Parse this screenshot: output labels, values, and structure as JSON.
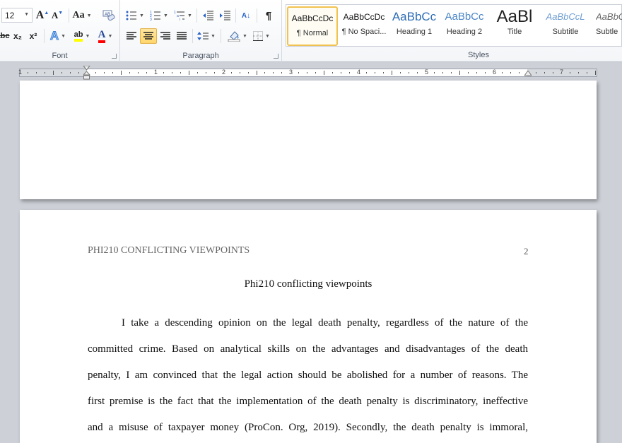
{
  "ribbon": {
    "font": {
      "label": "Font",
      "size": "12",
      "grow_font": "A",
      "shrink_font": "A",
      "change_case": "Aa",
      "strike": "abc",
      "subscript": "x₂",
      "superscript": "x²",
      "text_effects": "A",
      "highlight": "ab",
      "font_color": "A",
      "highlight_color": "#ffff00",
      "font_color_value": "#ff0000"
    },
    "paragraph": {
      "label": "Paragraph",
      "show_marks": "¶",
      "sort": "A↓"
    },
    "styles": {
      "label": "Styles",
      "items": [
        {
          "sample": "AaBbCcDc",
          "name": "¶ Normal",
          "selected": true
        },
        {
          "sample": "AaBbCcDc",
          "name": "¶ No Spaci..."
        },
        {
          "sample": "AaBbCc",
          "name": "Heading 1"
        },
        {
          "sample": "AaBbCc",
          "name": "Heading 2"
        },
        {
          "sample": "AaBl",
          "name": "Title"
        },
        {
          "sample": "AaBbCcL",
          "name": "Subtitle"
        },
        {
          "sample": "AaBbC",
          "name": "Subtle"
        }
      ]
    }
  },
  "ruler": {
    "numbers": [
      "1",
      "1",
      "2",
      "3",
      "4",
      "5",
      "6",
      "7"
    ]
  },
  "document": {
    "header_text": "PHI210 CONFLICTING VIEWPOINTS",
    "page_number": "2",
    "title": "Phi210 conflicting viewpoints",
    "lines": [
      "I take a descending opinion on the legal death penalty, regardless of the nature of the",
      "committed crime. Based on analytical skills on the advantages and disadvantages of the death",
      "penalty, I am convinced that the legal action should be abolished for a number of reasons. The",
      "first premise is the fact that the implementation of the death penalty is discriminatory, ineffective",
      "and a misuse of taxpayer money (ProCon. Org, 2019). Secondly, the death penalty is immoral,"
    ]
  }
}
